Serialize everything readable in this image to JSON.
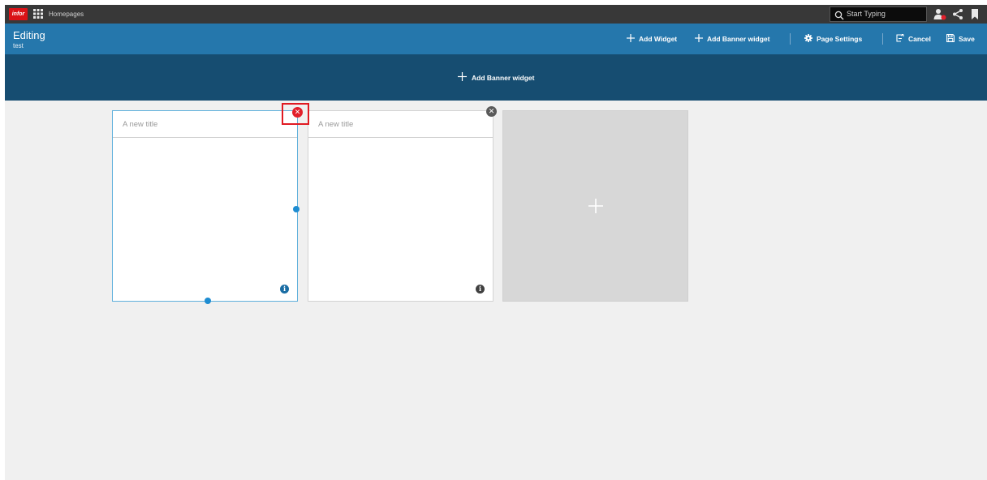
{
  "topbar": {
    "logo_text": "infor",
    "app_name": "Homepages",
    "search": {
      "placeholder": "Start Typing"
    },
    "icons": [
      "apps-grid-icon",
      "search-icon",
      "user-icon",
      "share-icon",
      "bookmark-icon"
    ]
  },
  "edit_header": {
    "title": "Editing",
    "subtitle": "test",
    "actions": {
      "add_widget": "Add Widget",
      "add_banner_widget": "Add Banner widget",
      "page_settings": "Page Settings",
      "cancel": "Cancel",
      "save": "Save"
    }
  },
  "banner": {
    "add_banner_label": "Add Banner widget"
  },
  "widgets": [
    {
      "title": "A new title",
      "selected": true,
      "close_color": "#e2202b"
    },
    {
      "title": "A new title",
      "selected": false,
      "close_color": "#5a5a5a"
    }
  ],
  "colors": {
    "topbar": "#383838",
    "edit_header": "#2577ac",
    "banner": "#164d71",
    "canvas": "#f0f0f0",
    "selection": "#5fb0dc",
    "highlight": "#e01a22"
  }
}
